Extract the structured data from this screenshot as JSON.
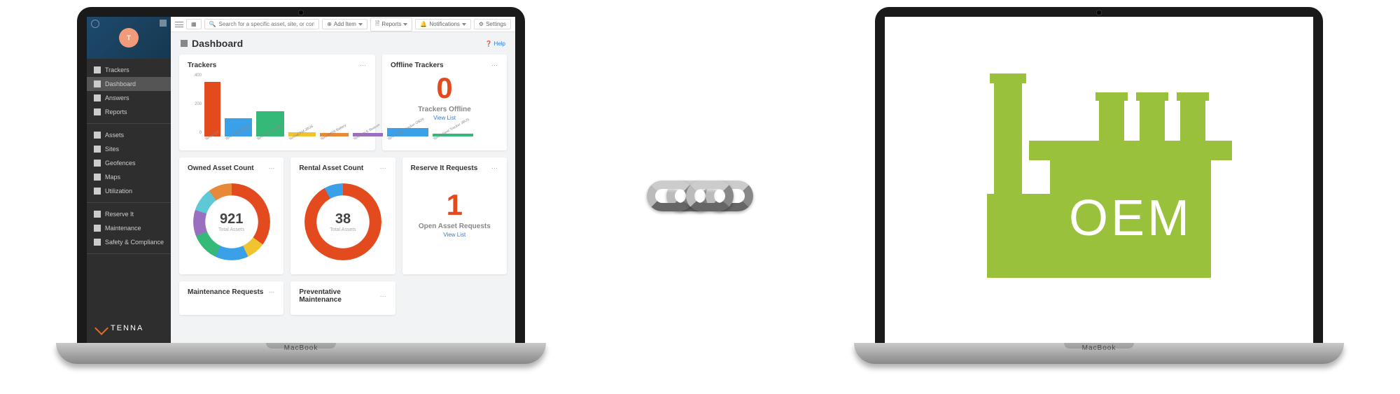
{
  "laptop_label": "MacBook",
  "avatar_letter": "T",
  "brand": "TENNA",
  "sidebar": {
    "groups": [
      [
        "Trackers",
        "Dashboard",
        "Answers",
        "Reports"
      ],
      [
        "Assets",
        "Sites",
        "Geofences",
        "Maps",
        "Utilization"
      ],
      [
        "Reserve It",
        "Maintenance",
        "Safety & Compliance"
      ]
    ],
    "active": "Dashboard"
  },
  "topbar": {
    "search_placeholder": "Search for a specific asset, site, or contact",
    "add_item": "Add Item",
    "reports": "Reports",
    "notifications": "Notifications",
    "settings": "Settings"
  },
  "page_title": "Dashboard",
  "help": "Help",
  "cards": {
    "trackers": {
      "title": "Trackers"
    },
    "offline": {
      "title": "Offline Trackers",
      "value": "0",
      "sub": "Trackers Offline",
      "link": "View List"
    },
    "owned": {
      "title": "Owned Asset Count",
      "value": "921",
      "sub": "Total Assets"
    },
    "rental": {
      "title": "Rental Asset Count",
      "value": "38",
      "sub": "Total Assets"
    },
    "reserve": {
      "title": "Reserve It Requests",
      "value": "1",
      "sub": "Open Asset Requests",
      "link": "View List"
    },
    "maint": {
      "title": "Maintenance Requests"
    },
    "prevent": {
      "title": "Preventative Maintenance"
    }
  },
  "chart_data": {
    "type": "bar",
    "title": "Trackers",
    "xlabel": "",
    "ylabel": "",
    "ylim": [
      0,
      400
    ],
    "y_ticks": [
      0,
      200,
      400
    ],
    "categories": [
      "Tenna QR",
      "TennaMINI Plugin",
      "TennaCAM OBDII",
      "TennaCAM JBUS",
      "TennaMINI Battery",
      "Tenna BLE Beacon",
      "Tenna Fleet Tracker OBDII",
      "Tenna Fleet Tracker JBUS"
    ],
    "values": [
      390,
      130,
      180,
      30,
      25,
      25,
      60,
      20
    ],
    "colors": [
      "#e34b1f",
      "#3aa0e8",
      "#35b978",
      "#f0c330",
      "#e8893a",
      "#9a6fbf",
      "#3aa0e8",
      "#35b978"
    ]
  },
  "donuts": {
    "owned": {
      "segments": [
        {
          "color": "#e34b1f",
          "pct": 35
        },
        {
          "color": "#f0c330",
          "pct": 8
        },
        {
          "color": "#3aa0e8",
          "pct": 14
        },
        {
          "color": "#35b978",
          "pct": 12
        },
        {
          "color": "#9a6fbf",
          "pct": 11
        },
        {
          "color": "#5fc8d6",
          "pct": 10
        },
        {
          "color": "#e8893a",
          "pct": 10
        }
      ]
    },
    "rental": {
      "segments": [
        {
          "color": "#e34b1f",
          "pct": 92
        },
        {
          "color": "#3aa0e8",
          "pct": 8
        }
      ]
    }
  },
  "oem_label": "OEM"
}
